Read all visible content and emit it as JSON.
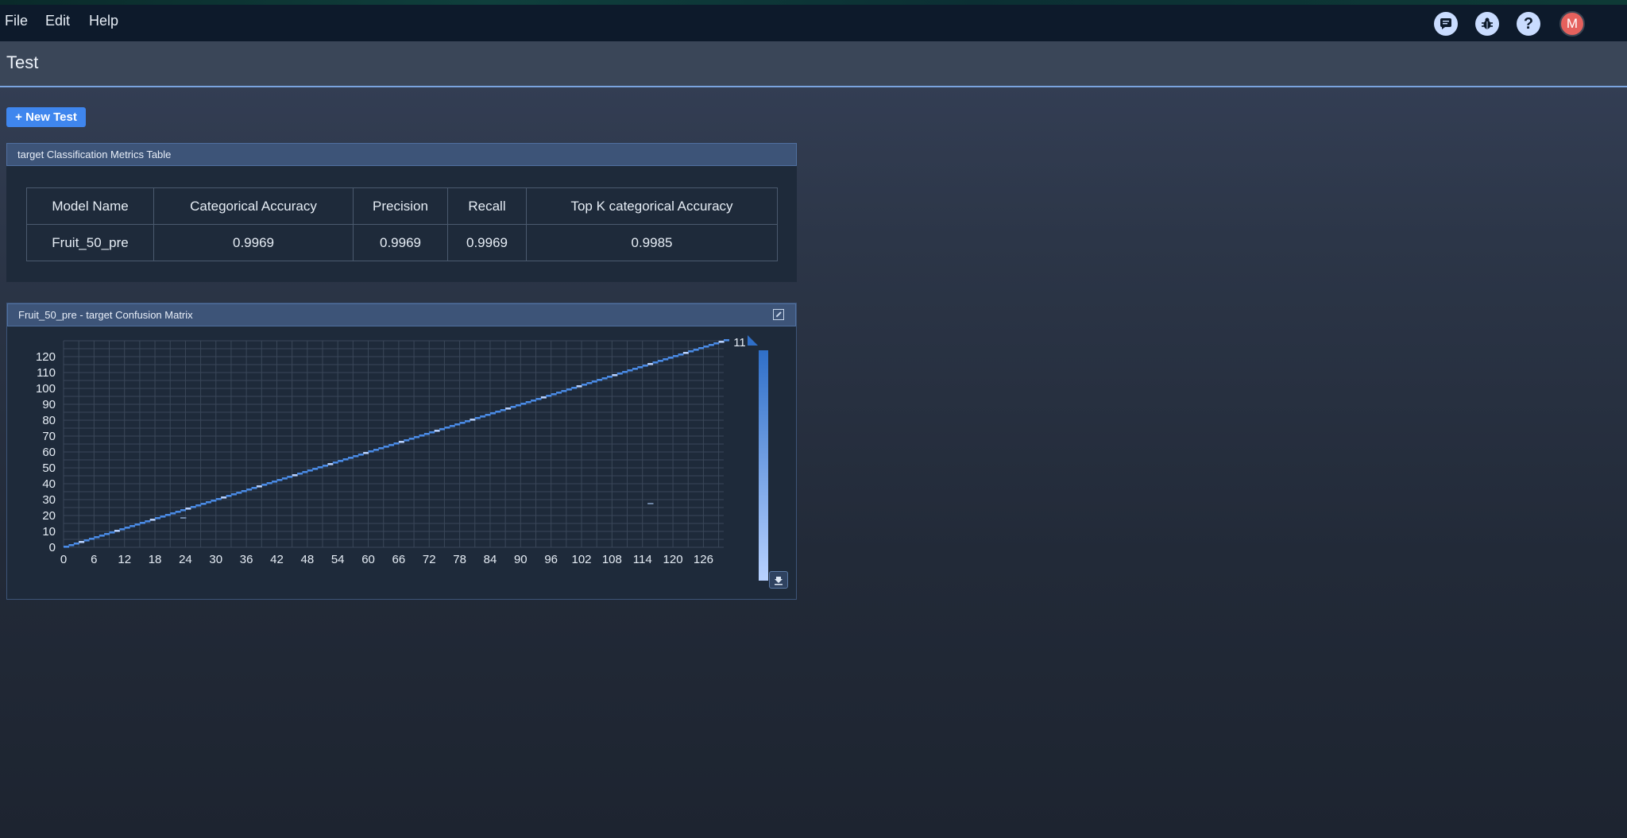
{
  "menu": {
    "file": "File",
    "edit": "Edit",
    "help": "Help"
  },
  "top_icons": [
    "chat-icon",
    "bug-icon",
    "help-icon"
  ],
  "user": {
    "avatar_letter": "M",
    "avatar_color": "#e5615d"
  },
  "page": {
    "title": "Test",
    "new_test_label": "+ New Test"
  },
  "metrics": {
    "title": "target Classification Metrics Table",
    "headers": [
      "Model Name",
      "Categorical Accuracy",
      "Precision",
      "Recall",
      "Top K categorical Accuracy"
    ],
    "rows": [
      [
        "Fruit_50_pre",
        "0.9969",
        "0.9969",
        "0.9969",
        "0.9985"
      ]
    ]
  },
  "confusion": {
    "title": "Fruit_50_pre - target Confusion Matrix",
    "colorbar_max_label": "11"
  },
  "chart_data": {
    "type": "heatmap",
    "n_classes": 131,
    "x_ticks": [
      0,
      6,
      12,
      18,
      24,
      30,
      36,
      42,
      48,
      54,
      60,
      66,
      72,
      78,
      84,
      90,
      96,
      102,
      108,
      114,
      120,
      126
    ],
    "y_ticks": [
      0,
      10,
      20,
      30,
      40,
      50,
      60,
      70,
      80,
      90,
      100,
      110,
      120
    ],
    "xlim": [
      0,
      130
    ],
    "ylim": [
      0,
      130
    ],
    "diagonal": true,
    "off_diagonal": [
      {
        "x": 23,
        "y": 18
      },
      {
        "x": 115,
        "y": 27
      }
    ],
    "colorbar": {
      "max": 11,
      "color_low": "#b7d1ff",
      "color_high": "#2f6fc8"
    }
  }
}
